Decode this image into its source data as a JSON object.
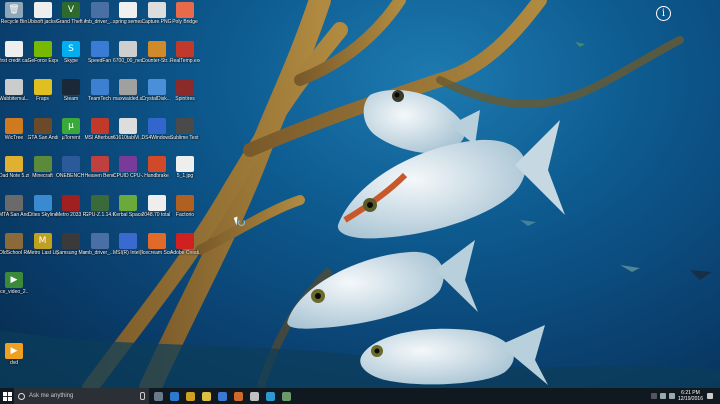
{
  "desktop": {
    "icons": [
      {
        "label": "Recycle Bin",
        "color": "#8fa6b8",
        "glyph": "🗑"
      },
      {
        "label": "Ubisoft jacks thre...",
        "color": "#eeeeee",
        "glyph": ""
      },
      {
        "label": "Grand Theft Auto V",
        "color": "#2d6b2d",
        "glyph": "V"
      },
      {
        "label": "mb_driver_...",
        "color": "#4a6fa5",
        "glyph": ""
      },
      {
        "label": "spring semester s...",
        "color": "#f0f0f0",
        "glyph": ""
      },
      {
        "label": "Capture.PNG",
        "color": "#dddddd",
        "glyph": ""
      },
      {
        "label": "Poly Bridge",
        "color": "#e86a4a",
        "glyph": ""
      },
      {
        "label": "first credit card.PNG",
        "color": "#eeeeee",
        "glyph": ""
      },
      {
        "label": "GeForce Experience",
        "color": "#76b900",
        "glyph": ""
      },
      {
        "label": "Skype",
        "color": "#00aff0",
        "glyph": "S"
      },
      {
        "label": "SpeedFan",
        "color": "#3a7bd5",
        "glyph": ""
      },
      {
        "label": "6700_00_neo...",
        "color": "#cfcfcf",
        "glyph": ""
      },
      {
        "label": "Counter-Str... Global Offe...",
        "color": "#d08a2a",
        "glyph": ""
      },
      {
        "label": "RealTemp.exe - Shortcut",
        "color": "#c0392b",
        "glyph": ""
      },
      {
        "label": "WabbitemuL...",
        "color": "#cccccc",
        "glyph": ""
      },
      {
        "label": "Fraps",
        "color": "#e0c020",
        "glyph": ""
      },
      {
        "label": "Steam",
        "color": "#1b2838",
        "glyph": ""
      },
      {
        "label": "TeamTech",
        "color": "#3d7fd0",
        "glyph": ""
      },
      {
        "label": "maxwaided.s...",
        "color": "#a0a0a0",
        "glyph": ""
      },
      {
        "label": "CrystalDisk... 5",
        "color": "#4a90d9",
        "glyph": ""
      },
      {
        "label": "Spintires",
        "color": "#8b2a2a",
        "glyph": ""
      },
      {
        "label": "WicTree",
        "color": "#d07a20",
        "glyph": ""
      },
      {
        "label": "GTA San Andreas",
        "color": "#6b4a2a",
        "glyph": ""
      },
      {
        "label": "µTorrent",
        "color": "#3aa83a",
        "glyph": "µ"
      },
      {
        "label": "MSI Afterburner",
        "color": "#c0392b",
        "glyph": ""
      },
      {
        "label": "61610tablVi...",
        "color": "#dddddd",
        "glyph": ""
      },
      {
        "label": "DS4Windows",
        "color": "#3366cc",
        "glyph": ""
      },
      {
        "label": "Sublime Text 3",
        "color": "#4a4a4a",
        "glyph": ""
      },
      {
        "label": "Dad Note 5.zip",
        "color": "#e0b030",
        "glyph": ""
      },
      {
        "label": "Minecraft",
        "color": "#5a8a3a",
        "glyph": ""
      },
      {
        "label": "ONEBENCH Windows 64 Bit - Shortcut",
        "color": "#2a5a9a",
        "glyph": ""
      },
      {
        "label": "Heaven Benchma...",
        "color": "#c04040",
        "glyph": ""
      },
      {
        "label": "CPUID CPU-Z",
        "color": "#7a3a9a",
        "glyph": ""
      },
      {
        "label": "Handbrake",
        "color": "#d04a2a",
        "glyph": ""
      },
      {
        "label": "5_1.jpg",
        "color": "#eeeeee",
        "glyph": ""
      },
      {
        "label": "MTA San Andreas 1.5",
        "color": "#6a6a6a",
        "glyph": ""
      },
      {
        "label": "Cities Skylines",
        "color": "#3a8ad0",
        "glyph": ""
      },
      {
        "label": "Metro 2033 Redux",
        "color": "#a02020",
        "glyph": ""
      },
      {
        "label": "GPU-Z.1.14.0 - Shortcut",
        "color": "#3a6a3a",
        "glyph": ""
      },
      {
        "label": "Kerbal Space Program",
        "color": "#6aaa3a",
        "glyph": ""
      },
      {
        "label": "2048.70 total pay from 5...",
        "color": "#eeeeee",
        "glyph": ""
      },
      {
        "label": "Factorio",
        "color": "#b06020",
        "glyph": ""
      },
      {
        "label": "OldSchool RuneScape",
        "color": "#8a6a3a",
        "glyph": ""
      },
      {
        "label": "Metro Last Light Redux",
        "color": "#c0a020",
        "glyph": "M"
      },
      {
        "label": "Samsung Magician",
        "color": "#3a3a3a",
        "glyph": ""
      },
      {
        "label": "mb_driver_...",
        "color": "#4a6fa5",
        "glyph": ""
      },
      {
        "label": "MSI(R) Intel(R) Ext...",
        "color": "#3a6ad0",
        "glyph": ""
      },
      {
        "label": "Icecream Screen ...",
        "color": "#e06a2a",
        "glyph": ""
      },
      {
        "label": "Adobe Creati...",
        "color": "#d02020",
        "glyph": ""
      },
      {
        "label": "ice_video_2...",
        "color": "#3a8a3a",
        "glyph": "▶"
      },
      {
        "label": "dvd",
        "color": "#f0a020",
        "glyph": "▶"
      }
    ]
  },
  "taskbar": {
    "search_placeholder": "Ask me anything",
    "apps": [
      {
        "name": "task-view",
        "color": "#6a7a8a"
      },
      {
        "name": "edge",
        "color": "#2a7ad0"
      },
      {
        "name": "chrome",
        "color": "#d0a020"
      },
      {
        "name": "explorer",
        "color": "#e0c040"
      },
      {
        "name": "store",
        "color": "#3a7ad0"
      },
      {
        "name": "app-1",
        "color": "#d06a2a"
      },
      {
        "name": "app-2",
        "color": "#c0c0c0"
      },
      {
        "name": "app-3",
        "color": "#2a9ad0"
      },
      {
        "name": "app-4",
        "color": "#6a9a6a"
      }
    ],
    "time": "6:21 PM",
    "date": "12/19/2016"
  }
}
